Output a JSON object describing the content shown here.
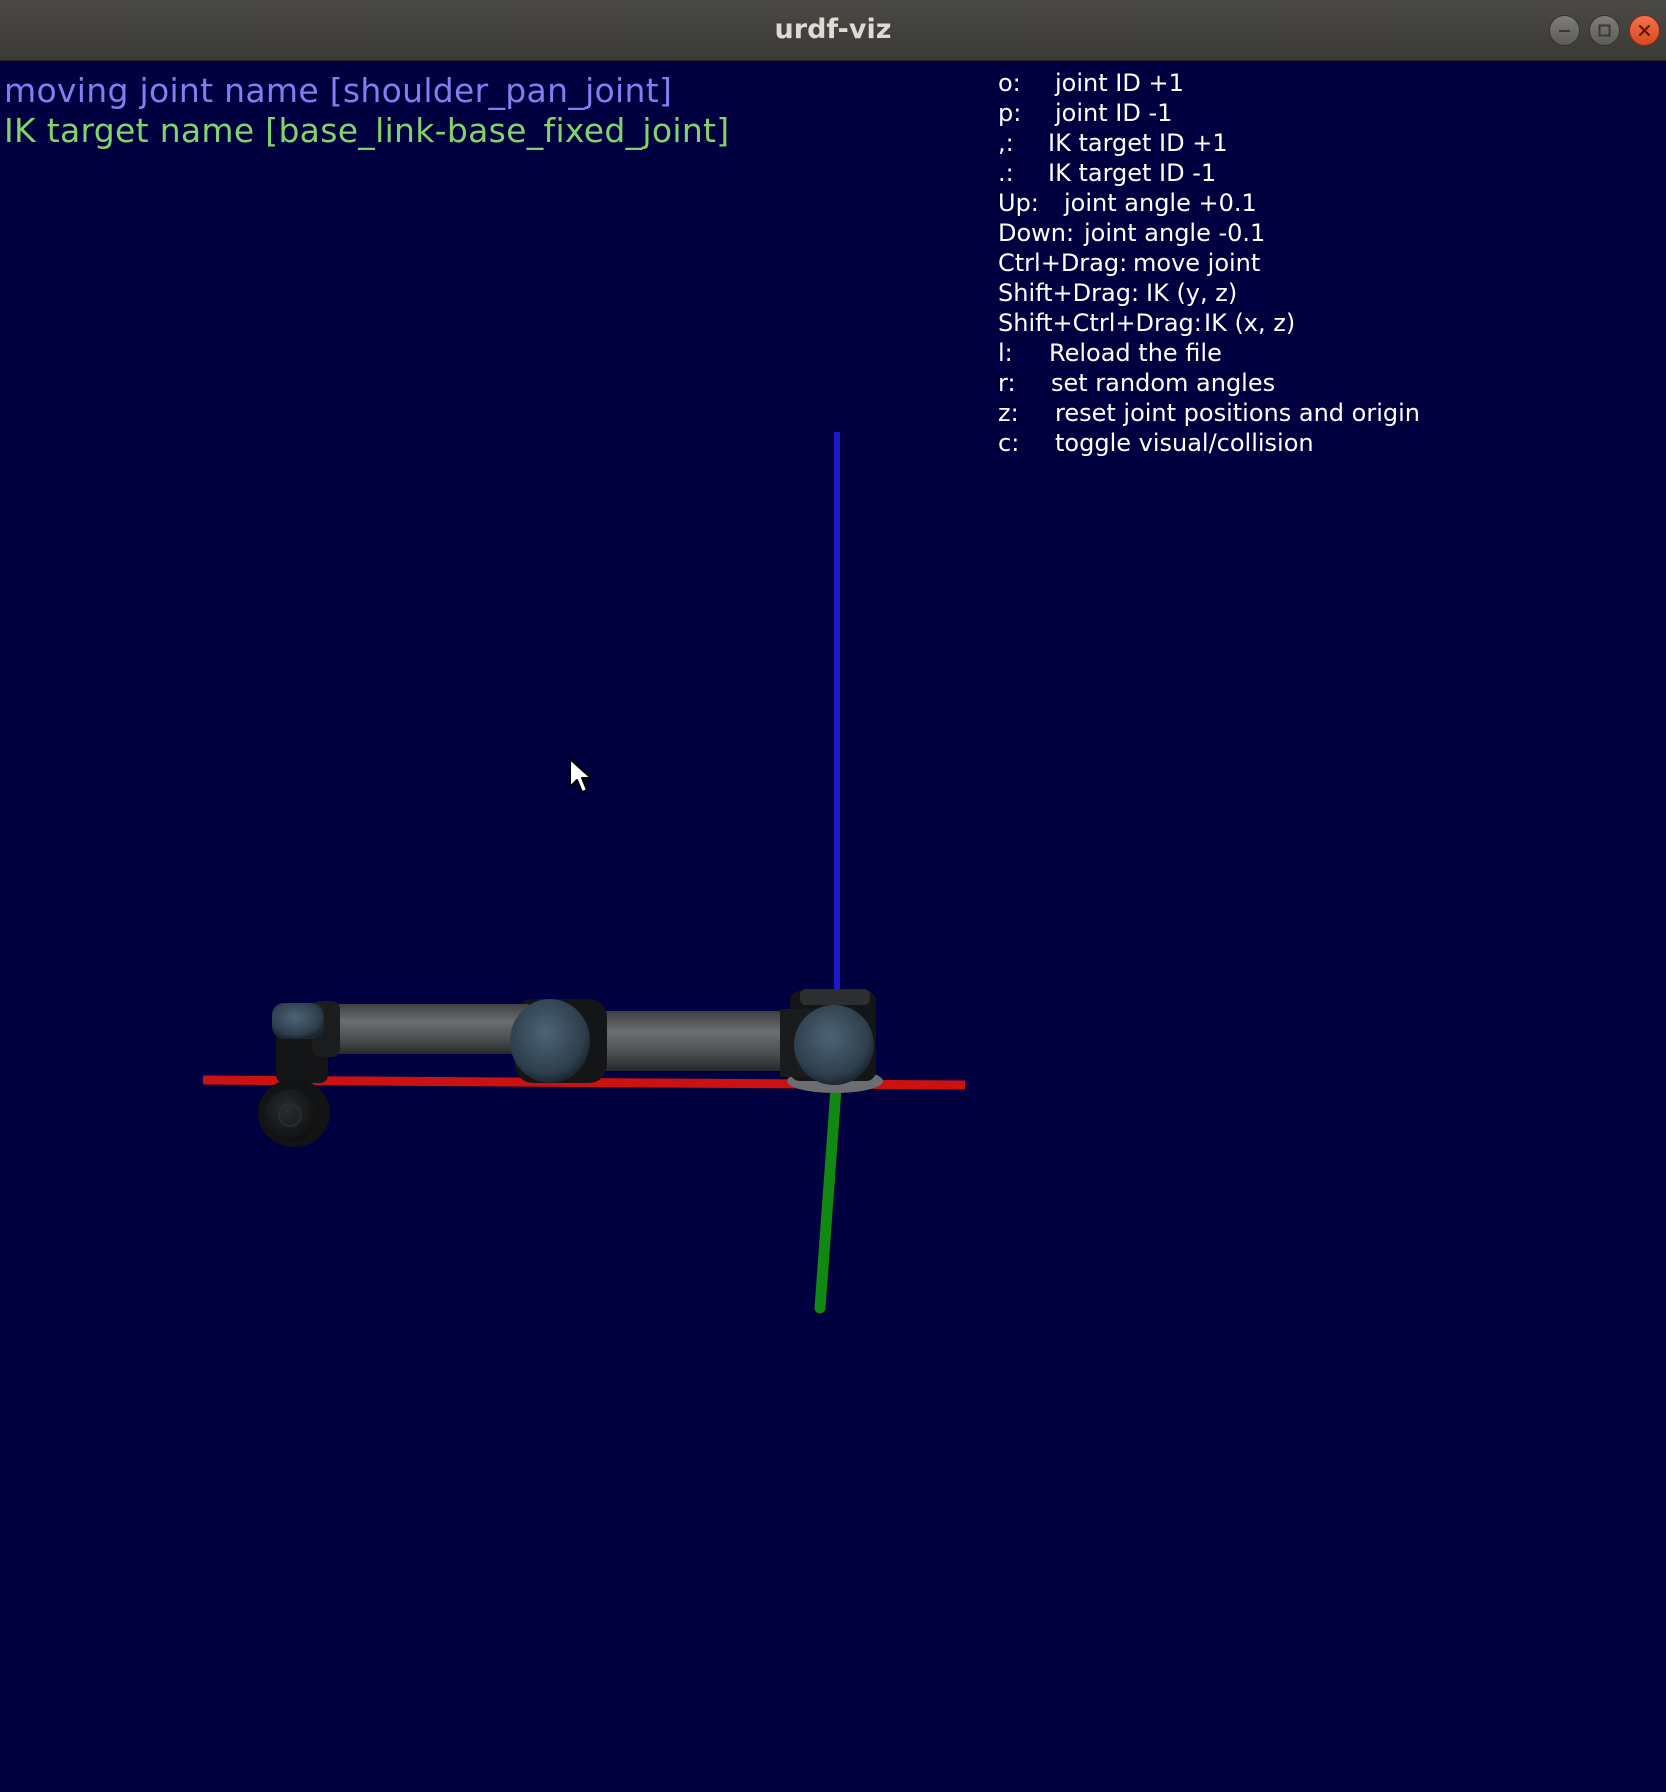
{
  "window": {
    "title": "urdf-viz",
    "controls": [
      "minimize-icon",
      "maximize-icon",
      "close-icon"
    ]
  },
  "status": {
    "moving_joint": "moving joint name [shoulder_pan_joint]",
    "ik_target": "IK target name [base_link-base_fixed_joint]"
  },
  "help": [
    {
      "key": "o:",
      "desc": "joint ID +1"
    },
    {
      "key": "p:",
      "desc": "joint ID -1"
    },
    {
      "key": ",:",
      "desc": "IK target ID +1"
    },
    {
      "key": ".:",
      "desc": "IK target ID -1"
    },
    {
      "key": "Up:",
      "desc": "joint angle +0.1"
    },
    {
      "key": "Down:",
      "desc": "joint angle -0.1"
    },
    {
      "key": "Ctrl+Drag:",
      "desc": "move joint"
    },
    {
      "key": "Shift+Drag:",
      "desc": "IK (y, z)"
    },
    {
      "key": "Shift+Ctrl+Drag:",
      "desc": "IK (x, z)"
    },
    {
      "key": "l:",
      "desc": "Reload the file"
    },
    {
      "key": "r:",
      "desc": "set random angles"
    },
    {
      "key": "z:",
      "desc": "reset joint positions and origin"
    },
    {
      "key": "c:",
      "desc": "toggle visual/collision"
    }
  ],
  "colors": {
    "background": "#000040",
    "moving_joint_text": "#7f7fef",
    "ik_target_text": "#7fd46a",
    "help_text": "#ffffff",
    "x_axis": "#cc1111",
    "y_axis": "#118811",
    "z_axis": "#1a1ac8"
  },
  "icons": {
    "cursor": "mouse-pointer-icon"
  }
}
